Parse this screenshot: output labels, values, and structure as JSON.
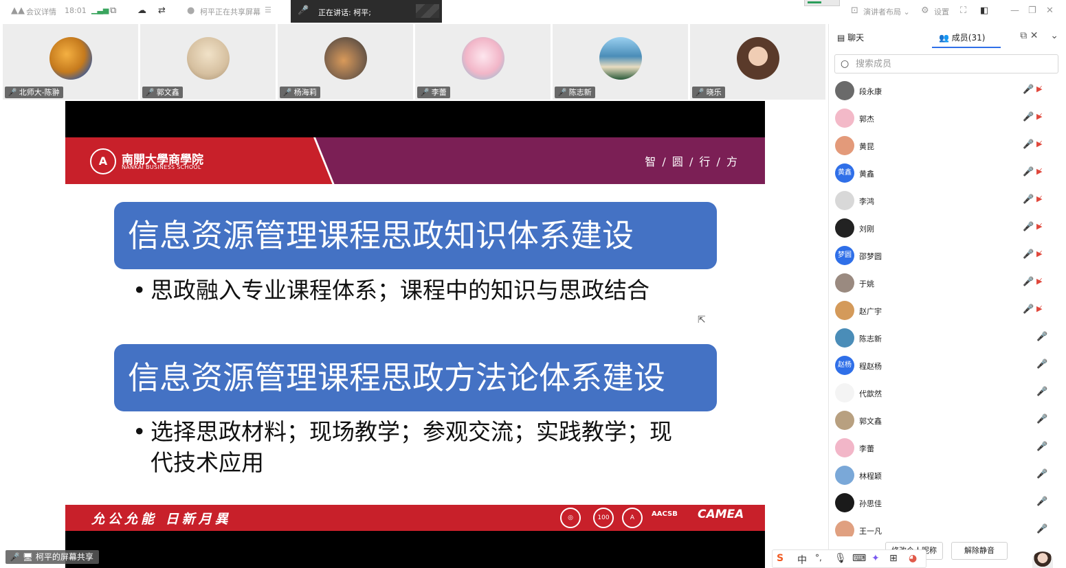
{
  "topbar": {
    "meeting_details": "会议详情",
    "time": "18:01",
    "sharing_status": "柯平正在共享屏幕",
    "speaking_label": "正在讲话:",
    "speaking_name": "柯平;",
    "layout_label": "演讲者布局",
    "settings_label": "设置",
    "icons": [
      "logo-icon",
      "signal-icon",
      "popout-icon",
      "cloud-icon",
      "translate-icon",
      "user-icon",
      "menu-icon",
      "fullscreen-icon",
      "sidebar-toggle-icon",
      "minimize-icon",
      "restore-icon",
      "close-icon"
    ]
  },
  "participants": [
    {
      "name": "北师大-陈翀",
      "color": "#c57a1d"
    },
    {
      "name": "郭文鑫",
      "color": "#d6c0a0"
    },
    {
      "name": "杨海莉",
      "color": "#8a6a4e"
    },
    {
      "name": "李蕾",
      "color": "#f2b6c8"
    },
    {
      "name": "陈志新",
      "color": "#4a8db8"
    },
    {
      "name": "晓乐",
      "color": "#5a3a2a"
    }
  ],
  "slide": {
    "school_cn": "南開大學商學院",
    "school_en": "NANKAI BUSINESS SCHOOL",
    "motto": "智 / 圆 / 行 / 方",
    "heading1": "信息资源管理课程思政知识体系建设",
    "bullet1": "思政融入专业课程体系；课程中的知识与思政结合",
    "heading2": "信息资源管理课程思政方法论体系建设",
    "bullet2": "选择思政材料；现场教学；参观交流；实践教学；现代技术应用",
    "footer_motto": "允公允能 日新月異",
    "badge_100": "100",
    "aacsb": "AACSB",
    "camea": "CAMEA"
  },
  "share_label": "柯平的屏幕共享",
  "panel": {
    "tab_chat": "聊天",
    "tab_members": "成员(31)",
    "search_placeholder": "搜索成员",
    "members": [
      {
        "name": "段永康",
        "color": "#6a6a6a",
        "initials": "",
        "cam_off": true
      },
      {
        "name": "郭杰",
        "color": "#f3b9c8",
        "initials": "",
        "cam_off": true
      },
      {
        "name": "黄昆",
        "color": "#e39a7a",
        "initials": "",
        "cam_off": true
      },
      {
        "name": "黄鑫",
        "color": "#2f6fe8",
        "initials": "黄鑫",
        "cam_off": true
      },
      {
        "name": "李鸿",
        "color": "#d8d8d8",
        "initials": "",
        "cam_off": true
      },
      {
        "name": "刘刚",
        "color": "#222222",
        "initials": "",
        "cam_off": true
      },
      {
        "name": "邵梦圆",
        "color": "#2f6fe8",
        "initials": "梦圆",
        "cam_off": true
      },
      {
        "name": "于姚",
        "color": "#9a8a80",
        "initials": "",
        "cam_off": true
      },
      {
        "name": "赵广宇",
        "color": "#d49a5a",
        "initials": "",
        "cam_off": true
      },
      {
        "name": "陈志新",
        "color": "#4a8db8",
        "initials": "",
        "cam_off": false
      },
      {
        "name": "程赵杨",
        "color": "#2f6fe8",
        "initials": "赵杨",
        "cam_off": false
      },
      {
        "name": "代歆然",
        "color": "#f4f4f4",
        "initials": "",
        "cam_off": false
      },
      {
        "name": "郭文鑫",
        "color": "#b8a080",
        "initials": "",
        "cam_off": false
      },
      {
        "name": "李蕾",
        "color": "#f2b6c8",
        "initials": "",
        "cam_off": false
      },
      {
        "name": "林程颖",
        "color": "#7aa8d8",
        "initials": "",
        "cam_off": false
      },
      {
        "name": "孙思佳",
        "color": "#1a1a1a",
        "initials": "",
        "cam_off": false
      },
      {
        "name": "王一凡",
        "color": "#e0a080",
        "initials": "",
        "cam_off": false
      }
    ],
    "rename_btn": "修改个人昵称",
    "unmute_btn": "解除静音"
  },
  "ime": {
    "lang": "中",
    "punct": "°,"
  }
}
